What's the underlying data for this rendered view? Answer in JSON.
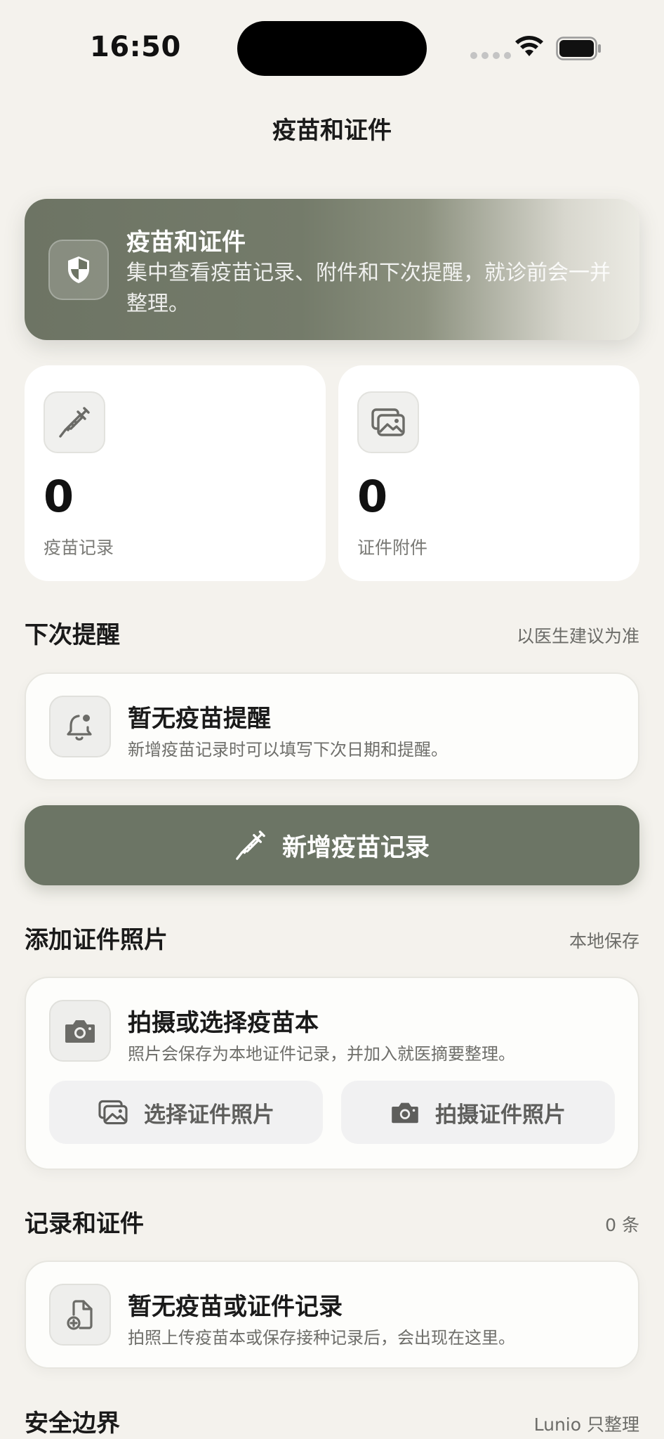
{
  "status_bar": {
    "time": "16:50"
  },
  "nav": {
    "title": "疫苗和证件"
  },
  "hero": {
    "title": "疫苗和证件",
    "description": "集中查看疫苗记录、附件和下次提醒，就诊前会一并整理。"
  },
  "stats": [
    {
      "value": "0",
      "label": "疫苗记录",
      "icon": "syringe-icon"
    },
    {
      "value": "0",
      "label": "证件附件",
      "icon": "photos-icon"
    }
  ],
  "next_reminder": {
    "title": "下次提醒",
    "note": "以医生建议为准",
    "card_title": "暂无疫苗提醒",
    "card_desc": "新增疫苗记录时可以填写下次日期和提醒。"
  },
  "add_record_button": {
    "label": "新增疫苗记录"
  },
  "add_photo": {
    "title": "添加证件照片",
    "note": "本地保存",
    "card_title": "拍摄或选择疫苗本",
    "card_desc": "照片会保存为本地证件记录，并加入就医摘要整理。",
    "choose_label": "选择证件照片",
    "capture_label": "拍摄证件照片"
  },
  "records": {
    "title": "记录和证件",
    "count": "0 条",
    "card_title": "暂无疫苗或证件记录",
    "card_desc": "拍照上传疫苗本或保存接种记录后，会出现在这里。"
  },
  "safety": {
    "title": "安全边界",
    "note": "Lunio 只整理"
  },
  "colors": {
    "background": "#f4f2ed",
    "accent": "#6c7565",
    "card": "#ffffff"
  }
}
